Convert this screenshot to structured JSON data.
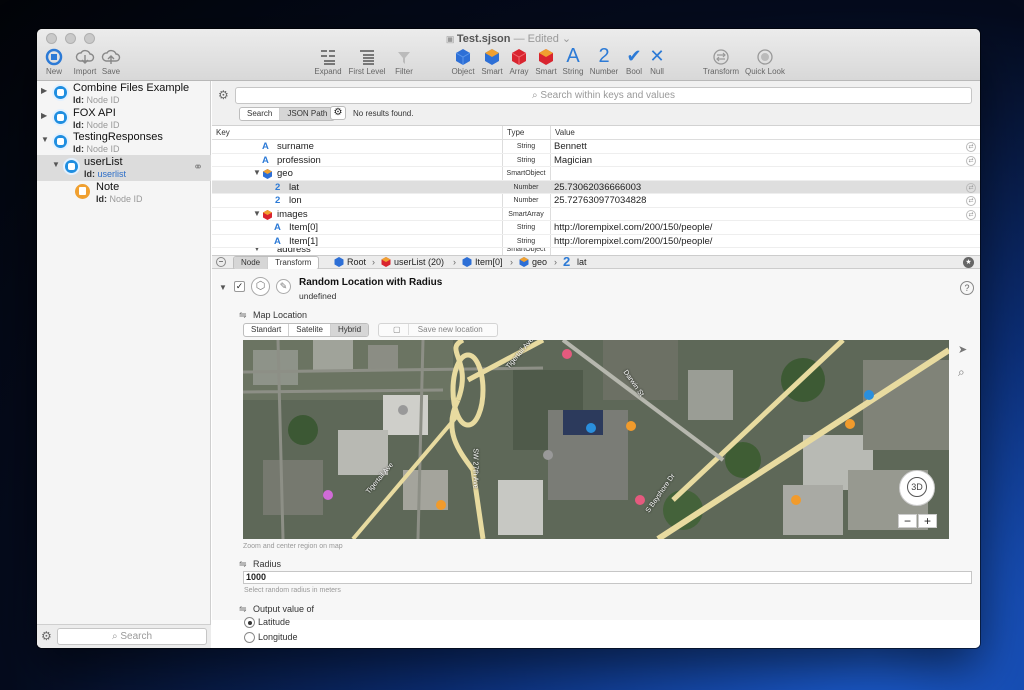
{
  "window": {
    "title": "Test.sjson",
    "subtitle": "— Edited ⌄"
  },
  "toolbar": {
    "left": [
      {
        "label": "New",
        "icon": "new-icon"
      },
      {
        "label": "Import",
        "icon": "import-icon"
      },
      {
        "label": "Save",
        "icon": "save-icon"
      }
    ],
    "middle": [
      {
        "label": "Expand",
        "icon": "expand-icon"
      },
      {
        "label": "First Level",
        "icon": "first-level-icon"
      },
      {
        "label": "Filter",
        "icon": "filter-icon"
      }
    ],
    "types": [
      {
        "label": "Object",
        "icon": "object-cube-icon",
        "color": "#2d6fd6"
      },
      {
        "label": "Smart",
        "icon": "smart-object-icon",
        "color": "#e88a1d"
      },
      {
        "label": "Array",
        "icon": "array-cube-icon",
        "color": "#d9242f"
      },
      {
        "label": "Smart",
        "icon": "smart-array-icon",
        "color": "#d9242f"
      },
      {
        "label": "String",
        "icon": "string-icon",
        "glyph": "A"
      },
      {
        "label": "Number",
        "icon": "number-icon",
        "glyph": "2"
      },
      {
        "label": "Bool",
        "icon": "bool-icon",
        "glyph": "✔"
      },
      {
        "label": "Null",
        "icon": "null-icon",
        "glyph": "✕"
      }
    ],
    "right": [
      {
        "label": "Transform",
        "icon": "transform-icon"
      },
      {
        "label": "Quick Look",
        "icon": "quick-look-icon"
      }
    ]
  },
  "sidebar": {
    "items": [
      {
        "name": "Combine Files Example",
        "id_label": "Id:",
        "id_value": "Node ID"
      },
      {
        "name": "FOX API",
        "id_label": "Id:",
        "id_value": "Node ID"
      },
      {
        "name": "TestingResponses",
        "id_label": "Id:",
        "id_value": "Node ID"
      },
      {
        "name": "userList",
        "id_label": "Id:",
        "id_value": "userlist"
      },
      {
        "name": "Note",
        "id_label": "Id:",
        "id_value": "Node ID"
      }
    ],
    "search_placeholder": "Search"
  },
  "search": {
    "placeholder": "Search within keys and values",
    "mode_search": "Search",
    "mode_jsonpath": "JSON Path",
    "status": "No results found."
  },
  "table": {
    "headers": {
      "key": "Key",
      "type": "Type",
      "value": "Value"
    },
    "rows": [
      {
        "key": "surname",
        "type": "String",
        "value": "Bennett"
      },
      {
        "key": "profession",
        "type": "String",
        "value": "Magician"
      },
      {
        "key": "geo",
        "type": "SmartObject",
        "value": ""
      },
      {
        "key": "lat",
        "type": "Number",
        "value": "25.73062036666003"
      },
      {
        "key": "lon",
        "type": "Number",
        "value": "25.727630977034828"
      },
      {
        "key": "images",
        "type": "SmartArray",
        "value": ""
      },
      {
        "key": "Item[0]",
        "type": "String",
        "value": "http://lorempixel.com/200/150/people/"
      },
      {
        "key": "Item[1]",
        "type": "String",
        "value": "http://lorempixel.com/200/150/people/"
      },
      {
        "key": "address",
        "type": "SmartObject",
        "value": ""
      }
    ]
  },
  "breadcrumb": {
    "tab_node": "Node",
    "tab_transform": "Transform",
    "path": [
      "Root",
      "userList (20)",
      "Item[0]",
      "geo",
      "lat"
    ]
  },
  "transform": {
    "title": "Random Location with Radius",
    "subtitle": "undefined",
    "map_section": "Map Location",
    "map_modes": [
      "Standart",
      "Satelite",
      "Hybrid"
    ],
    "save_location": "Save new location",
    "map_hint": "Zoom and center region on map",
    "map_labels": [
      "Tigertail Ave",
      "SW 27th Ave",
      "Tigertail Ave",
      "Darwin St",
      "S Bayshore Dr"
    ],
    "compass": "3D",
    "radius_label": "Radius",
    "radius_value": "1000",
    "radius_hint": "Select random radius in meters",
    "output_label": "Output value of",
    "options": [
      "Latitude",
      "Longitude"
    ],
    "selected_option": "Latitude"
  }
}
